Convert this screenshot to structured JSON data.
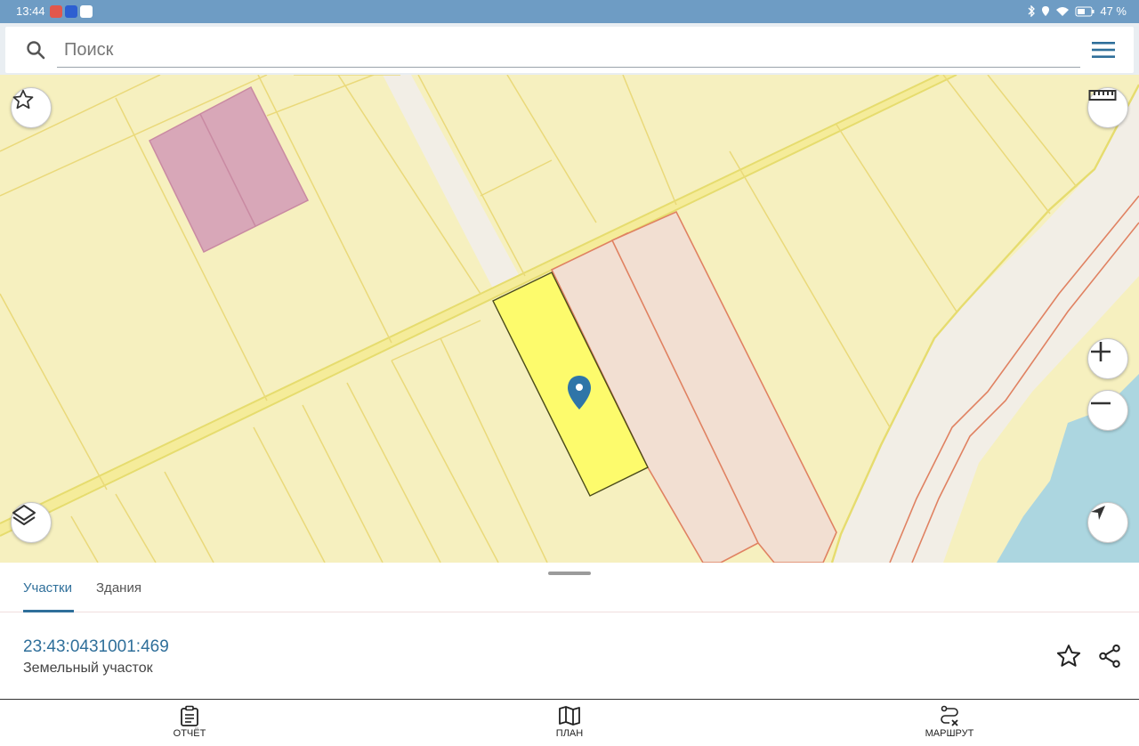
{
  "status_bar": {
    "time": "13:44",
    "battery": "47 %",
    "icons": [
      "bluetooth-icon",
      "location-icon",
      "wifi-icon",
      "battery-icon"
    ]
  },
  "search": {
    "placeholder": "Поиск"
  },
  "map": {
    "colors": {
      "land": "#f6f0bf",
      "parcel_line": "#e4d77a",
      "selected_parcel": "#fdfb6c",
      "pink_parcel": "#d8a7b8",
      "red_parcel_fill": "#f2dfd2",
      "red_parcel_line": "#e08262",
      "road": "#f2eee6",
      "water": "#acd6e0",
      "marker": "#2f75a8"
    },
    "controls": [
      "star-icon",
      "ruler-icon",
      "zoom-in-icon",
      "zoom-out-icon",
      "layers-icon",
      "navigation-arrow-icon"
    ]
  },
  "panel": {
    "tabs": [
      {
        "label": "Участки",
        "active": true
      },
      {
        "label": "Здания",
        "active": false
      }
    ],
    "parcel_id": "23:43:0431001:469",
    "parcel_type": "Земельный участок"
  },
  "bottom_nav": {
    "items": [
      {
        "label": "ОТЧЁТ",
        "icon": "clipboard-icon"
      },
      {
        "label": "ПЛАН",
        "icon": "map-icon"
      },
      {
        "label": "МАРШРУТ",
        "icon": "route-icon"
      }
    ]
  }
}
